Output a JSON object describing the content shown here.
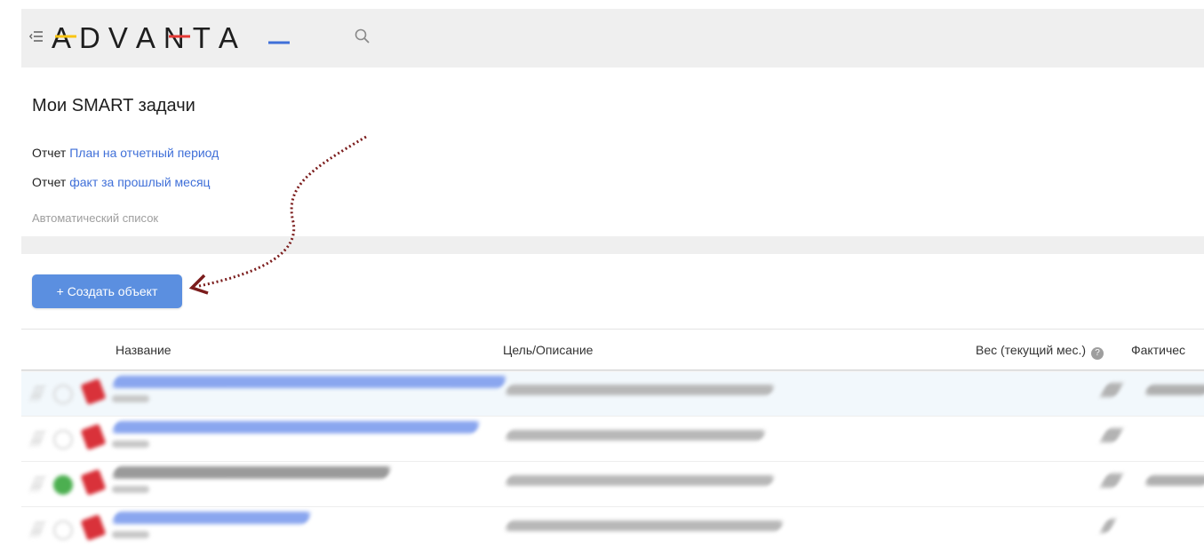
{
  "header": {
    "logo_letters": [
      "A",
      "D",
      "V",
      "A",
      "N",
      "T",
      "A"
    ],
    "menu_icon": "collapse-menu-icon",
    "search_icon": "search-icon"
  },
  "page": {
    "title": "Мои SMART задачи",
    "reports": [
      {
        "prefix": "Отчет",
        "link": "План на отчетный период"
      },
      {
        "prefix": "Отчет",
        "link": "факт за прошлый месяц"
      }
    ],
    "auto_list_label": "Автоматический список"
  },
  "toolbar": {
    "create_label": "+ Создать объект"
  },
  "table": {
    "columns": [
      "Название",
      "Цель/Описание",
      "Вес (текущий мес.)",
      "Фактичес"
    ],
    "help_glyph": "?",
    "rows": [
      {
        "status": "empty",
        "highlighted": true,
        "has_fact": true
      },
      {
        "status": "empty",
        "highlighted": false,
        "has_fact": false
      },
      {
        "status": "done",
        "highlighted": false,
        "has_fact": true
      },
      {
        "status": "empty",
        "highlighted": false,
        "has_fact": false
      }
    ]
  },
  "colors": {
    "accent_button": "#5b8fe0",
    "link": "#3f6fd8",
    "muted_text": "#9e9e9e",
    "arrow": "#7b1c1c",
    "logo_red": "#e53935",
    "logo_yellow": "#f9c513",
    "logo_blue": "#3f6fd8"
  }
}
